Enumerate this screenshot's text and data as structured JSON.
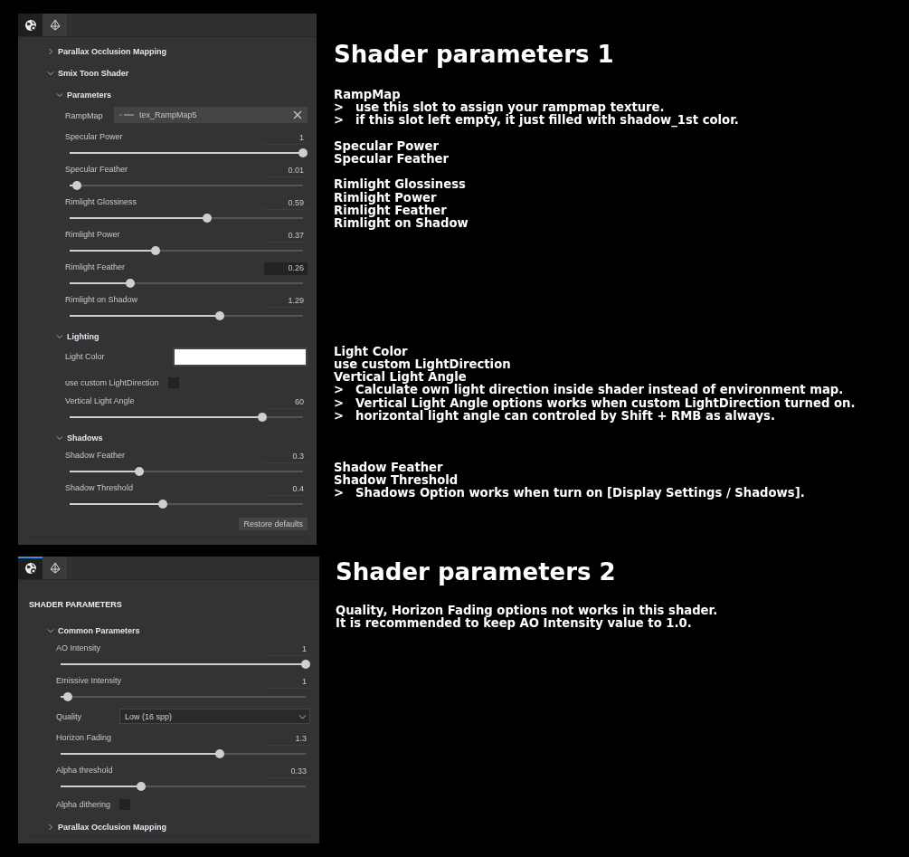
{
  "sections": [
    {
      "panel": {
        "accent_bar": false,
        "tabs": [
          {
            "selected": true
          },
          {
            "selected": false
          }
        ],
        "rows": [
          {
            "kind": "group",
            "label": "Parallax Occlusion Mapping",
            "expanded": false
          },
          {
            "kind": "group",
            "label": "Smix Toon Shader",
            "expanded": true,
            "children": [
              {
                "kind": "group",
                "label": "Parameters",
                "expanded": true,
                "children": [
                  {
                    "kind": "texture",
                    "label": "RampMap",
                    "value": "tex_RampMap5"
                  },
                  {
                    "kind": "slider",
                    "label": "Specular Power",
                    "value": "1",
                    "level": 1,
                    "focused": false
                  },
                  {
                    "kind": "slider",
                    "label": "Specular Feather",
                    "value": "0.01",
                    "level": 0.03,
                    "focused": false
                  },
                  {
                    "kind": "slider",
                    "label": "Rimlight Glossiness",
                    "value": "0.59",
                    "level": 0.59,
                    "focused": false
                  },
                  {
                    "kind": "slider",
                    "label": "Rimlight Power",
                    "value": "0.37",
                    "level": 0.37,
                    "focused": false
                  },
                  {
                    "kind": "slider",
                    "label": "Rimlight Feather",
                    "value": "0.26",
                    "level": 0.26,
                    "focused": true
                  },
                  {
                    "kind": "slider",
                    "label": "Rimlight on Shadow",
                    "value": "1.29",
                    "level": 0.645,
                    "focused": false
                  }
                ]
              },
              {
                "kind": "group",
                "label": "Lighting",
                "expanded": true,
                "children": [
                  {
                    "kind": "color",
                    "label": "Light Color",
                    "color": "#ffffff"
                  },
                  {
                    "kind": "checkbox",
                    "label": "use custom LightDirection",
                    "checked": false
                  },
                  {
                    "kind": "slider",
                    "label": "Vertical Light Angle",
                    "value": "60",
                    "level": 0.825,
                    "focused": false
                  }
                ]
              },
              {
                "kind": "group",
                "label": "Shadows",
                "expanded": true,
                "children": [
                  {
                    "kind": "slider",
                    "label": "Shadow Feather",
                    "value": "0.3",
                    "level": 0.3,
                    "focused": false
                  },
                  {
                    "kind": "slider",
                    "label": "Shadow Threshold",
                    "value": "0.4",
                    "level": 0.4,
                    "focused": false
                  }
                ]
              },
              {
                "kind": "button",
                "label": "Restore defaults"
              }
            ]
          }
        ]
      },
      "notes": {
        "title": "Shader parameters 1",
        "blocks": [
          {
            "lines": [
              {
                "kind": "item",
                "text": "RampMap"
              },
              {
                "kind": "bullet",
                "marker": ">",
                "text": "use this slot to assign your rampmap texture."
              },
              {
                "kind": "bullet",
                "marker": ">",
                "text": "if this slot left empty, it just filled with shadow_1st color."
              }
            ]
          },
          {
            "lines": [
              {
                "kind": "item",
                "text": "Specular Power"
              },
              {
                "kind": "item",
                "text": "Specular Feather"
              }
            ]
          },
          {
            "lines": [
              {
                "kind": "item",
                "text": "Rimlight Glossiness"
              },
              {
                "kind": "item",
                "text": "Rimlight Power"
              },
              {
                "kind": "item",
                "text": "Rimlight Feather"
              },
              {
                "kind": "item",
                "text": "Rimlight on Shadow"
              }
            ]
          },
          {
            "lines": [
              {
                "kind": "item",
                "text": "Light Color"
              },
              {
                "kind": "item",
                "text": "use custom LightDirection"
              },
              {
                "kind": "item",
                "text": "Vertical Light Angle"
              },
              {
                "kind": "bullet",
                "marker": ">",
                "text": "Calculate own light direction inside shader instead of environment map."
              },
              {
                "kind": "bullet",
                "marker": ">",
                "text": "Vertical Light Angle options works when custom LightDirection turned on."
              },
              {
                "kind": "bullet",
                "marker": ">",
                "text": "horizontal light angle can controled by Shift + RMB as always."
              }
            ]
          },
          {
            "lines": [
              {
                "kind": "item",
                "text": "Shadow Feather"
              },
              {
                "kind": "item",
                "text": "Shadow Threshold"
              },
              {
                "kind": "bullet",
                "marker": ">",
                "text": "Shadows Option works when turn on [Display Settings / Shadows]."
              }
            ]
          }
        ]
      }
    },
    {
      "panel": {
        "accent_bar": true,
        "tabs": [
          {
            "selected": true
          },
          {
            "selected": false
          }
        ],
        "heading": "SHADER PARAMETERS",
        "rows": [
          {
            "kind": "group",
            "label": "Common Parameters",
            "expanded": true,
            "children": [
              {
                "kind": "slider",
                "label": "AO Intensity",
                "value": "1",
                "level": 1,
                "focused": false
              },
              {
                "kind": "slider",
                "label": "Emissive Intensity",
                "value": "1",
                "level": 0.03,
                "focused": false
              },
              {
                "kind": "dropdown",
                "label": "Quality",
                "value": "Low (16 spp)"
              },
              {
                "kind": "slider",
                "label": "Horizon Fading",
                "value": "1.3",
                "level": 0.65,
                "focused": false
              },
              {
                "kind": "slider",
                "label": "Alpha threshold",
                "value": "0.33",
                "level": 0.33,
                "focused": false
              },
              {
                "kind": "checkbox",
                "label": "Alpha dithering",
                "checked": false
              }
            ]
          },
          {
            "kind": "group",
            "label": "Parallax Occlusion Mapping",
            "expanded": false
          }
        ]
      },
      "notes": {
        "title": "Shader parameters 2",
        "blocks": [
          {
            "lines": [
              {
                "kind": "item",
                "text": "Quality, Horizon Fading options not works in this shader."
              },
              {
                "kind": "item",
                "text": "It is recommended to keep AO Intensity value to 1.0."
              }
            ]
          }
        ]
      }
    }
  ]
}
